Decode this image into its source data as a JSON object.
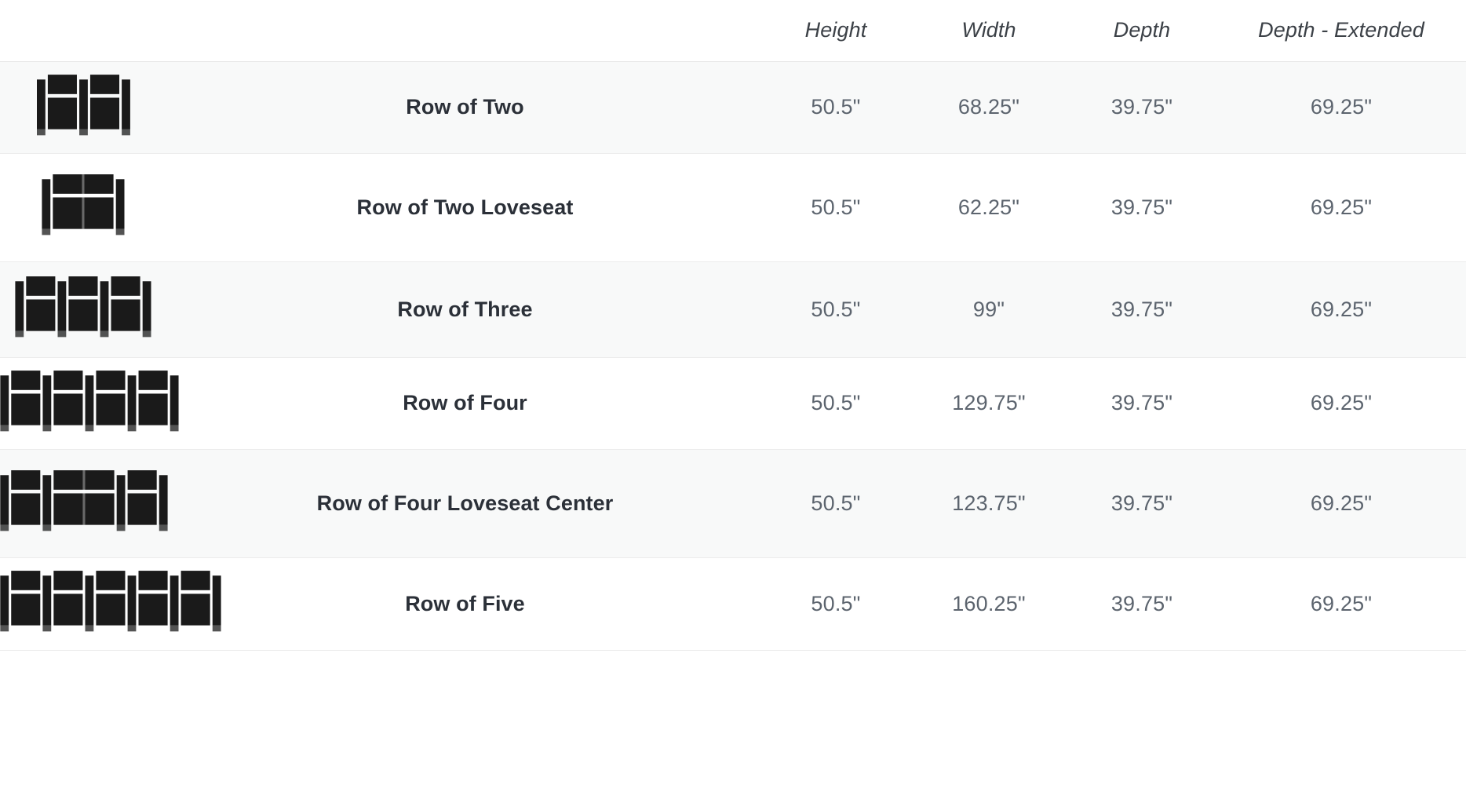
{
  "table": {
    "columns": [
      {
        "key": "icon",
        "label": ""
      },
      {
        "key": "name",
        "label": ""
      },
      {
        "key": "height",
        "label": "Height"
      },
      {
        "key": "width",
        "label": "Width"
      },
      {
        "key": "depth",
        "label": "Depth"
      },
      {
        "key": "depth_extended",
        "label": "Depth - Extended"
      }
    ],
    "rows": [
      {
        "icon": "row-of-two-seating-icon",
        "seats": 2,
        "loveseat_index": -1,
        "name": "Row of Two",
        "height": "50.5\"",
        "width": "68.25\"",
        "depth": "39.75\"",
        "depth_extended": "69.25\""
      },
      {
        "icon": "row-of-two-loveseat-seating-icon",
        "seats": 2,
        "loveseat_index": 0,
        "name": "Row of Two Loveseat",
        "height": "50.5\"",
        "width": "62.25\"",
        "depth": "39.75\"",
        "depth_extended": "69.25\""
      },
      {
        "icon": "row-of-three-seating-icon",
        "seats": 3,
        "loveseat_index": -1,
        "name": "Row of Three",
        "height": "50.5\"",
        "width": "99\"",
        "depth": "39.75\"",
        "depth_extended": "69.25\""
      },
      {
        "icon": "row-of-four-seating-icon",
        "seats": 4,
        "loveseat_index": -1,
        "name": "Row of Four",
        "height": "50.5\"",
        "width": "129.75\"",
        "depth": "39.75\"",
        "depth_extended": "69.25\""
      },
      {
        "icon": "row-of-four-loveseat-center-seating-icon",
        "seats": 4,
        "loveseat_index": 1,
        "name": "Row of Four Loveseat Center",
        "height": "50.5\"",
        "width": "123.75\"",
        "depth": "39.75\"",
        "depth_extended": "69.25\""
      },
      {
        "icon": "row-of-five-seating-icon",
        "seats": 5,
        "loveseat_index": -1,
        "name": "Row of Five",
        "height": "50.5\"",
        "width": "160.25\"",
        "depth": "39.75\"",
        "depth_extended": "69.25\""
      }
    ]
  },
  "style": {
    "icon_color": "#1a1a1a",
    "row_alt_background": "#f8f9f9",
    "row_background": "#ffffff",
    "border_color": "#ececec",
    "header_text_color": "#3c4147",
    "name_text_color": "#2b3038",
    "value_text_color": "#5c646e"
  }
}
